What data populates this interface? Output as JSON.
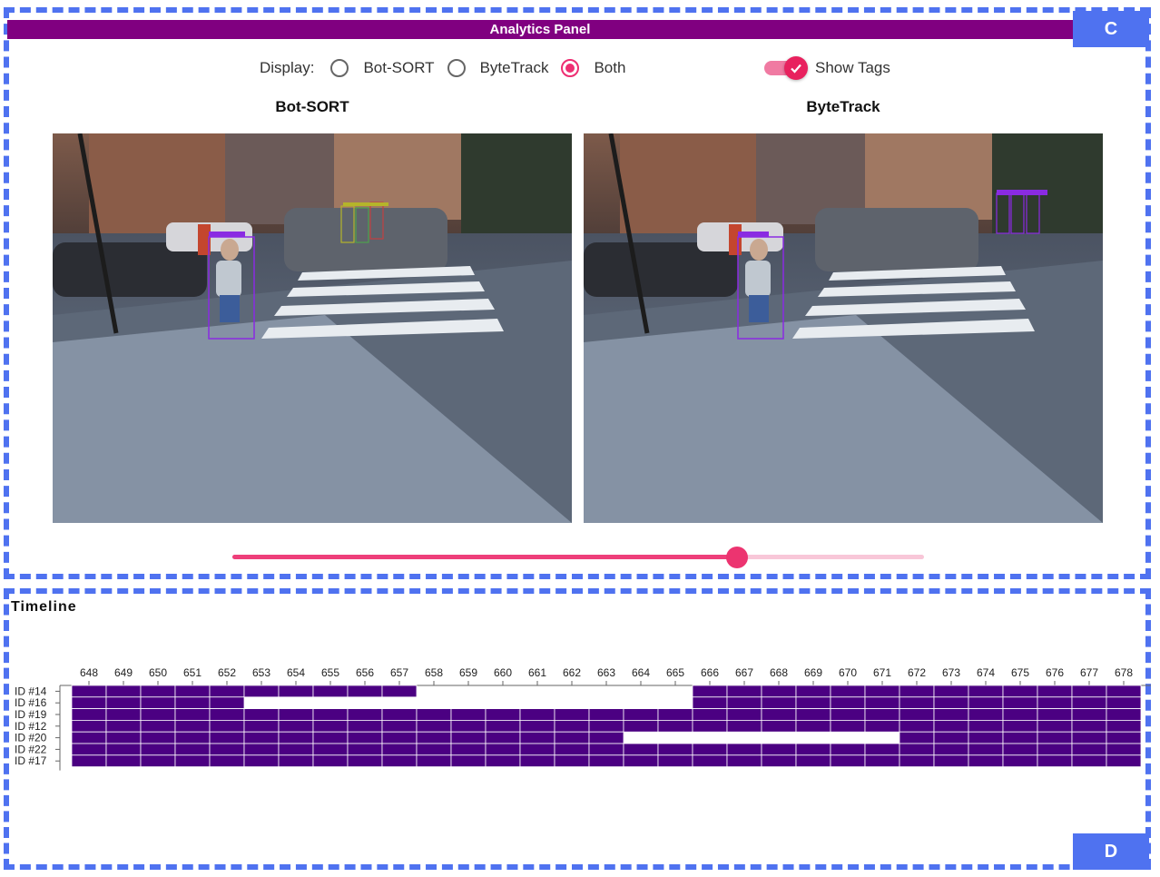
{
  "tags": {
    "upper": "C",
    "lower": "D"
  },
  "panel": {
    "title": "Analytics Panel"
  },
  "display": {
    "label": "Display:",
    "options": [
      "Bot-SORT",
      "ByteTrack",
      "Both"
    ],
    "selected": "Both"
  },
  "show_tags": {
    "label": "Show Tags",
    "checked": true
  },
  "panes": {
    "left_title": "Bot-SORT",
    "right_title": "ByteTrack"
  },
  "frame_slider": {
    "value_fraction": 0.73
  },
  "colors": {
    "accent": "#ee2e72",
    "track": "#4b0082",
    "dash": "#4f72f0",
    "header": "#800080"
  },
  "timeline": {
    "title": "Timeline",
    "frames": [
      648,
      649,
      650,
      651,
      652,
      653,
      654,
      655,
      656,
      657,
      658,
      659,
      660,
      661,
      662,
      663,
      664,
      665,
      666,
      667,
      668,
      669,
      670,
      671,
      672,
      673,
      674,
      675,
      676,
      677,
      678
    ],
    "tracks": [
      {
        "id": "ID #14",
        "segments": [
          [
            648,
            657
          ],
          [
            666,
            678
          ]
        ]
      },
      {
        "id": "ID #16",
        "segments": [
          [
            648,
            652
          ],
          [
            666,
            678
          ]
        ]
      },
      {
        "id": "ID #19",
        "segments": [
          [
            648,
            678
          ]
        ]
      },
      {
        "id": "ID #12",
        "segments": [
          [
            648,
            667
          ],
          [
            668,
            678
          ]
        ]
      },
      {
        "id": "ID #20",
        "segments": [
          [
            648,
            663
          ],
          [
            672,
            678
          ]
        ]
      },
      {
        "id": "ID #22",
        "segments": [
          [
            648,
            678
          ]
        ]
      },
      {
        "id": "ID #17",
        "segments": [
          [
            648,
            678
          ]
        ]
      }
    ]
  }
}
